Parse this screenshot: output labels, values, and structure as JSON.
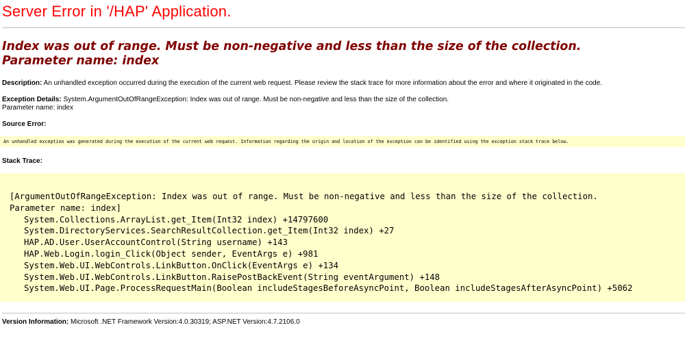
{
  "page_title": "Server Error in '/HAP' Application.",
  "error_message": {
    "line1": "Index was out of range. Must be non-negative and less than the size of the collection.",
    "line2": "Parameter name: index"
  },
  "description": {
    "label": "Description:",
    "text": "An unhandled exception occurred during the execution of the current web request. Please review the stack trace for more information about the error and where it originated in the code."
  },
  "exception_details": {
    "label": "Exception Details:",
    "text": "System.ArgumentOutOfRangeException: Index was out of range. Must be non-negative and less than the size of the collection.",
    "text2": "Parameter name: index"
  },
  "source_error": {
    "label": "Source Error:",
    "text": "An unhandled exception was generated during the execution of the current web request. Information regarding the origin and location of the exception can be identified using the exception stack trace below."
  },
  "stack_trace": {
    "label": "Stack Trace:",
    "header1": "[ArgumentOutOfRangeException: Index was out of range. Must be non-negative and less than the size of the collection.",
    "header2": "Parameter name: index]",
    "frames": [
      "System.Collections.ArrayList.get_Item(Int32 index) +14797600",
      "System.DirectoryServices.SearchResultCollection.get_Item(Int32 index) +27",
      "HAP.AD.User.UserAccountControl(String username) +143",
      "HAP.Web.Login.login_Click(Object sender, EventArgs e) +981",
      "System.Web.UI.WebControls.LinkButton.OnClick(EventArgs e) +134",
      "System.Web.UI.WebControls.LinkButton.RaisePostBackEvent(String eventArgument) +148",
      "System.Web.UI.Page.ProcessRequestMain(Boolean includeStagesBeforeAsyncPoint, Boolean includeStagesAfterAsyncPoint) +5062"
    ]
  },
  "version_info": {
    "label": "Version Information:",
    "text": "Microsoft .NET Framework Version:4.0.30319; ASP.NET Version:4.7.2106.0"
  },
  "colors": {
    "title": "#ff0000",
    "error_message": "#800000",
    "code_background": "#ffffcc",
    "rule": "#c0c0c0"
  }
}
